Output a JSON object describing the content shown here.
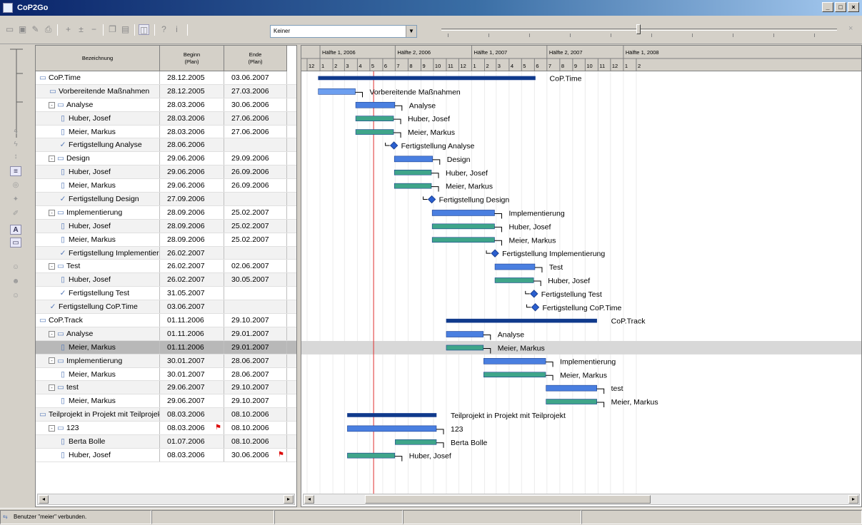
{
  "window": {
    "title": "CoP2Go",
    "buttons": [
      "_",
      "□",
      "×"
    ]
  },
  "toolbar": {
    "icons": [
      "new-icon",
      "save-icon",
      "edit-icon",
      "print-icon",
      "add-icon",
      "add-child-icon",
      "remove-icon",
      "copy-icon",
      "paste-icon",
      "layout-icon",
      "help-icon",
      "info-icon"
    ],
    "filter_combo_value": "Keiner",
    "close_glyph": "×"
  },
  "table": {
    "columns": [
      {
        "label": "Bezeichnung"
      },
      {
        "label": "Beginn",
        "sub": "(Plan)"
      },
      {
        "label": "Ende",
        "sub": "(Plan)"
      }
    ],
    "rows": [
      {
        "name": "CoP.Time",
        "begin": "28.12.2005",
        "end": "03.06.2007",
        "kind": "project",
        "level": 0
      },
      {
        "name": "Vorbereitende Maßnahmen",
        "begin": "28.12.2005",
        "end": "27.03.2006",
        "kind": "task",
        "level": 1
      },
      {
        "name": "Analyse",
        "begin": "28.03.2006",
        "end": "30.06.2006",
        "kind": "folder",
        "level": 1,
        "expand": "-"
      },
      {
        "name": "Huber, Josef",
        "begin": "28.03.2006",
        "end": "27.06.2006",
        "kind": "person",
        "level": 2
      },
      {
        "name": "Meier, Markus",
        "begin": "28.03.2006",
        "end": "27.06.2006",
        "kind": "person",
        "level": 2
      },
      {
        "name": "Fertigstellung Analyse",
        "begin": "28.06.2006",
        "end": "",
        "kind": "milestone",
        "level": 2
      },
      {
        "name": "Design",
        "begin": "29.06.2006",
        "end": "29.09.2006",
        "kind": "folder",
        "level": 1,
        "expand": "-"
      },
      {
        "name": "Huber, Josef",
        "begin": "29.06.2006",
        "end": "26.09.2006",
        "kind": "person",
        "level": 2
      },
      {
        "name": "Meier, Markus",
        "begin": "29.06.2006",
        "end": "26.09.2006",
        "kind": "person",
        "level": 2
      },
      {
        "name": "Fertigstellung Design",
        "begin": "27.09.2006",
        "end": "",
        "kind": "milestone",
        "level": 2
      },
      {
        "name": "Implementierung",
        "begin": "28.09.2006",
        "end": "25.02.2007",
        "kind": "folder",
        "level": 1,
        "expand": "-"
      },
      {
        "name": "Huber, Josef",
        "begin": "28.09.2006",
        "end": "25.02.2007",
        "kind": "person",
        "level": 2
      },
      {
        "name": "Meier, Markus",
        "begin": "28.09.2006",
        "end": "25.02.2007",
        "kind": "person",
        "level": 2
      },
      {
        "name": "Fertigstellung Implementierung",
        "begin": "26.02.2007",
        "end": "",
        "kind": "milestone",
        "level": 2
      },
      {
        "name": "Test",
        "begin": "26.02.2007",
        "end": "02.06.2007",
        "kind": "folder",
        "level": 1,
        "expand": "-"
      },
      {
        "name": "Huber, Josef",
        "begin": "26.02.2007",
        "end": "30.05.2007",
        "kind": "person",
        "level": 2
      },
      {
        "name": "Fertigstellung Test",
        "begin": "31.05.2007",
        "end": "",
        "kind": "milestone",
        "level": 2
      },
      {
        "name": "Fertigstellung CoP.Time",
        "begin": "03.06.2007",
        "end": "",
        "kind": "milestone",
        "level": 1
      },
      {
        "name": "CoP.Track",
        "begin": "01.11.2006",
        "end": "29.10.2007",
        "kind": "project",
        "level": 0
      },
      {
        "name": "Analyse",
        "begin": "01.11.2006",
        "end": "29.01.2007",
        "kind": "folder",
        "level": 1,
        "expand": "-"
      },
      {
        "name": "Meier, Markus",
        "begin": "01.11.2006",
        "end": "29.01.2007",
        "kind": "person",
        "level": 2,
        "selected": true
      },
      {
        "name": "Implementierung",
        "begin": "30.01.2007",
        "end": "28.06.2007",
        "kind": "folder",
        "level": 1,
        "expand": "-"
      },
      {
        "name": "Meier, Markus",
        "begin": "30.01.2007",
        "end": "28.06.2007",
        "kind": "person",
        "level": 2
      },
      {
        "name": "test",
        "begin": "29.06.2007",
        "end": "29.10.2007",
        "kind": "folder",
        "level": 1,
        "expand": "-"
      },
      {
        "name": "Meier, Markus",
        "begin": "29.06.2007",
        "end": "29.10.2007",
        "kind": "person",
        "level": 2
      },
      {
        "name": "Teilprojekt in Projekt mit Teilprojekt",
        "begin": "08.03.2006",
        "end": "08.10.2006",
        "kind": "project",
        "level": 0
      },
      {
        "name": "123",
        "begin": "08.03.2006",
        "end": "08.10.2006",
        "kind": "folder",
        "level": 1,
        "expand": "-",
        "begin_flag": true
      },
      {
        "name": "Berta Bolle",
        "begin": "01.07.2006",
        "end": "08.10.2006",
        "kind": "person",
        "level": 2
      },
      {
        "name": "Huber, Josef",
        "begin": "08.03.2006",
        "end": "30.06.2006",
        "kind": "person",
        "level": 2,
        "end_flag": true
      }
    ]
  },
  "gantt": {
    "halves": [
      "Hälfte 1, 2006",
      "Hälfte 2, 2006",
      "Hälfte 1, 2007",
      "Hälfte 2, 2007",
      "Hälfte 1, 2008"
    ],
    "months_start": "12",
    "today_line": "2006-05-10",
    "colors": {
      "project": "#0f3a8c",
      "group": "#4a7fe0",
      "group_light": "#6d9ff0",
      "person": "#3fa58a",
      "milestone": "#2a5fd0",
      "selected_row": "#d8d8d8",
      "today": "#e03030"
    },
    "labels": {
      "0": "CoP.Time",
      "1": "Vorbereitende Maßnahmen",
      "2": "Analyse",
      "3": "Huber, Josef",
      "4": "Meier, Markus",
      "5": "Fertigstellung Analyse",
      "6": "Design",
      "7": "Huber, Josef",
      "8": "Meier, Markus",
      "9": "Fertigstellung Design",
      "10": "Implementierung",
      "11": "Huber, Josef",
      "12": "Meier, Markus",
      "13": "Fertigstellung Implementierung",
      "14": "Test",
      "15": "Huber, Josef",
      "16": "Fertigstellung Test",
      "17": "Fertigstellung CoP.Time",
      "18": "CoP.Track",
      "19": "Analyse",
      "20": "Meier, Markus",
      "21": "Implementierung",
      "22": "Meier, Markus",
      "23": "test",
      "24": "Meier, Markus",
      "25": "Teilprojekt in Projekt mit Teilprojekt",
      "26": "123",
      "27": "Berta Bolle",
      "28": "Huber, Josef"
    }
  },
  "statusbar": {
    "text": "Benutzer \"meier\" verbunden."
  }
}
